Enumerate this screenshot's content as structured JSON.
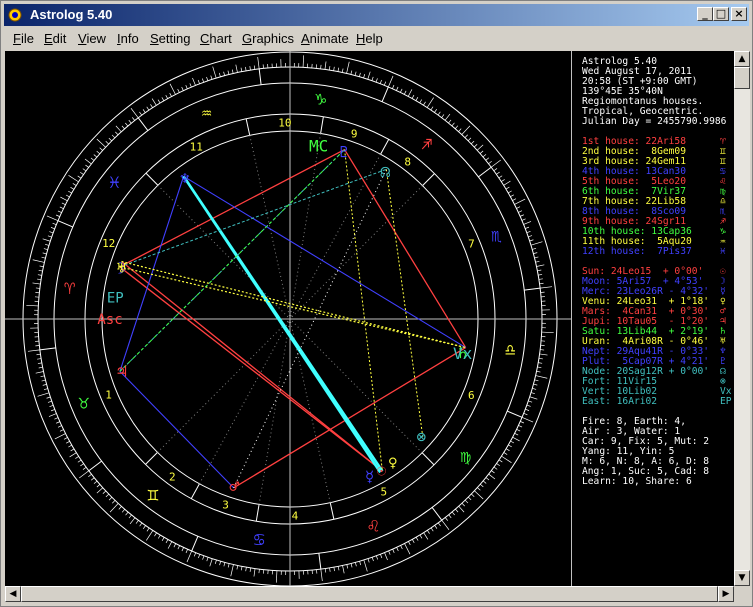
{
  "window": {
    "title": "Astrolog 5.40"
  },
  "menu": [
    "File",
    "Edit",
    "View",
    "Info",
    "Setting",
    "Chart",
    "Graphics",
    "Animate",
    "Help"
  ],
  "menu_underline": [
    "F",
    "E",
    "V",
    "I",
    "S",
    "C",
    "G",
    "A",
    "H"
  ],
  "info": {
    "header": [
      "Astrolog 5.40",
      "Wed August 17, 2011",
      "20:58 (ST +9:00 GMT)",
      "139°45E 35°40N",
      "Regiomontanus houses.",
      "Tropical, Geocentric.",
      "Julian Day = 2455790.9986"
    ],
    "houses": [
      {
        "text": "1st house: 22Ari58",
        "glyph": "♈",
        "color": "#ff4040"
      },
      {
        "text": "2nd house:  8Gem09",
        "glyph": "♊",
        "color": "#ffff40"
      },
      {
        "text": "3rd house: 24Gem11",
        "glyph": "♊",
        "color": "#ffff40"
      },
      {
        "text": "4th house: 13Can30",
        "glyph": "♋",
        "color": "#4040ff"
      },
      {
        "text": "5th house:  5Leo20",
        "glyph": "♌",
        "color": "#ff4040"
      },
      {
        "text": "6th house:  7Vir37",
        "glyph": "♍",
        "color": "#40ff40"
      },
      {
        "text": "7th house: 22Lib58",
        "glyph": "♎",
        "color": "#ffff40"
      },
      {
        "text": "8th house:  8Sco09",
        "glyph": "♏",
        "color": "#4040ff"
      },
      {
        "text": "9th house: 24Sgr11",
        "glyph": "♐",
        "color": "#ff4040"
      },
      {
        "text": "10th house: 13Cap36",
        "glyph": "♑",
        "color": "#40ff40"
      },
      {
        "text": "11th house:  5Aqu20",
        "glyph": "♒",
        "color": "#ffff40"
      },
      {
        "text": "12th house:  7Pis37",
        "glyph": "♓",
        "color": "#4040ff"
      }
    ],
    "planets": [
      {
        "text": "Sun: 24Leo15  + 0°00'",
        "glyph": "☉",
        "color": "#ff4040"
      },
      {
        "text": "Moon: 5Ari57  + 4°53'",
        "glyph": "☽",
        "color": "#4040ff"
      },
      {
        "text": "Merc: 23Leo26R - 4°32'",
        "glyph": "☿",
        "color": "#4040ff"
      },
      {
        "text": "Venu: 24Leo31  + 1°18'",
        "glyph": "♀",
        "color": "#ffff40"
      },
      {
        "text": "Mars:  4Can31  + 0°30'",
        "glyph": "♂",
        "color": "#ff4040"
      },
      {
        "text": "Jupi: 10Tau05  - 1°20'",
        "glyph": "♃",
        "color": "#ff4040"
      },
      {
        "text": "Satu: 13Lib44  + 2°19'",
        "glyph": "♄",
        "color": "#40ff40"
      },
      {
        "text": "Uran:  4Ari08R - 0°46'",
        "glyph": "♅",
        "color": "#ffff40"
      },
      {
        "text": "Nept: 29Aqu41R - 0°33'",
        "glyph": "♆",
        "color": "#4040ff"
      },
      {
        "text": "Plut:  5Cap07R + 4°21'",
        "glyph": "♇",
        "color": "#4040ff"
      },
      {
        "text": "Node: 20Sag12R + 0°00'",
        "glyph": "☊",
        "color": "#40c0c0"
      },
      {
        "text": "Fort: 11Vir15",
        "glyph": "⊗",
        "color": "#40c0c0"
      },
      {
        "text": "Vert: 10Lib02",
        "glyph": "Vx",
        "color": "#40c0c0"
      },
      {
        "text": "East: 16Ari02",
        "glyph": "EP",
        "color": "#40c0c0"
      }
    ],
    "stats": [
      "Fire: 8, Earth: 4,",
      "Air : 3, Water: 1",
      "Car: 9, Fix: 5, Mut: 2",
      "Yang: 11, Yin: 5",
      "M: 6, N: 8, A: 6, D: 8",
      "Ang: 1, Suc: 5, Cad: 8",
      "Learn: 10, Share: 6"
    ]
  },
  "wheel": {
    "house_numbers": [
      "1",
      "2",
      "3",
      "4",
      "5",
      "6",
      "7",
      "8",
      "9",
      "10",
      "11",
      "12"
    ],
    "cusps": [
      22.97,
      68.15,
      84.18,
      103.5,
      125.33,
      157.62,
      202.97,
      248.15,
      264.18,
      283.6,
      305.33,
      337.62
    ],
    "signs": [
      "♈",
      "♉",
      "♊",
      "♋",
      "♌",
      "♍",
      "♎",
      "♏",
      "♐",
      "♑",
      "♒",
      "♓"
    ],
    "sign_colors": [
      "#ff4040",
      "#40ff40",
      "#ffff40",
      "#4040ff",
      "#ff4040",
      "#40ff40",
      "#ffff40",
      "#4040ff",
      "#ff4040",
      "#40ff40",
      "#ffff40",
      "#4040ff"
    ],
    "mc_label": "MC",
    "asc_label": "Asc",
    "ep_label": "EP"
  }
}
